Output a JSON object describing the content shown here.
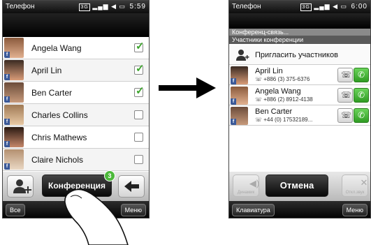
{
  "left_screen": {
    "status": {
      "title": "Телефон",
      "network": "3G",
      "time": "5:59"
    },
    "contacts": [
      {
        "name": "Angela Wang",
        "checked": true
      },
      {
        "name": "April Lin",
        "checked": true
      },
      {
        "name": "Ben Carter",
        "checked": true
      },
      {
        "name": "Charles Collins",
        "checked": false
      },
      {
        "name": "Chris Mathews",
        "checked": false
      },
      {
        "name": "Claire Nichols",
        "checked": false
      }
    ],
    "conference_button": "Конференция",
    "conference_badge": "3",
    "softkey_left": "Все",
    "softkey_right": "Меню"
  },
  "right_screen": {
    "status": {
      "title": "Телефон",
      "network": "3G",
      "time": "6:00"
    },
    "header_line1": "Конференц-связь...",
    "header_line2": "Участники конференции",
    "invite_label": "Пригласить участников",
    "participants": [
      {
        "name": "April Lin",
        "number": "+886 (3) 375-6376"
      },
      {
        "name": "Angela Wang",
        "number": "+886 (2) 8912-4138"
      },
      {
        "name": "Ben Carter",
        "number": "+44 (0) 17532189..."
      }
    ],
    "speaker_label": "Динамик",
    "cancel_button": "Отмена",
    "mute_label": "Откл.звук",
    "softkey_left": "Клавиатура",
    "softkey_right": "Меню"
  },
  "colors": {
    "check_green": "#3da52d",
    "call_green": "#3fae2f",
    "facebook_blue": "#3b5998"
  }
}
